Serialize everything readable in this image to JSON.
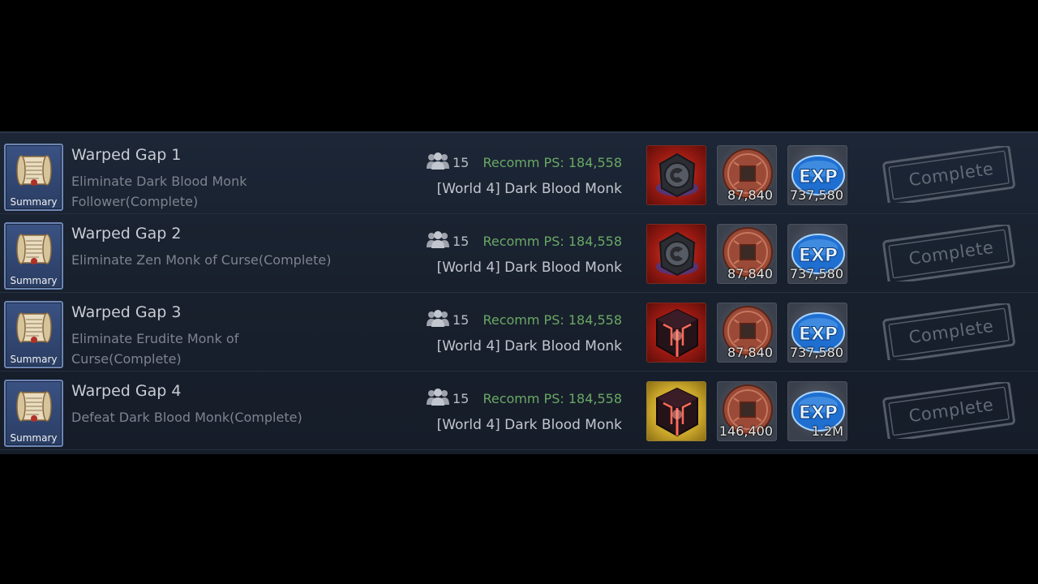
{
  "summary_label": "Summary",
  "complete_label": "Complete",
  "quests": [
    {
      "title": "Warped Gap 1",
      "description": "Eliminate Dark Blood Monk Follower(Complete)",
      "party_size": "15",
      "recomm": "Recomm PS: 184,558",
      "location": "[World 4] Dark Blood Monk",
      "item_icon": "dark-medallion-icon",
      "item_bg": "red",
      "coin_amount": "87,840",
      "exp_amount": "737,580"
    },
    {
      "title": "Warped Gap 2",
      "description": "Eliminate Zen Monk of Curse(Complete)",
      "party_size": "15",
      "recomm": "Recomm PS: 184,558",
      "location": "[World 4] Dark Blood Monk",
      "item_icon": "dark-medallion-icon",
      "item_bg": "red",
      "coin_amount": "87,840",
      "exp_amount": "737,580"
    },
    {
      "title": "Warped Gap 3",
      "description": "Eliminate Erudite Monk of Curse(Complete)",
      "party_size": "15",
      "recomm": "Recomm PS: 184,558",
      "location": "[World 4] Dark Blood Monk",
      "item_icon": "glowing-cube-icon",
      "item_bg": "red",
      "coin_amount": "87,840",
      "exp_amount": "737,580"
    },
    {
      "title": "Warped Gap 4",
      "description": "Defeat Dark Blood Monk(Complete)",
      "party_size": "15",
      "recomm": "Recomm PS: 184,558",
      "location": "[World 4] Dark Blood Monk",
      "item_icon": "glowing-cube-icon",
      "item_bg": "gold",
      "coin_amount": "146,400",
      "exp_amount": "1.2M"
    }
  ],
  "colors": {
    "recomm_green": "#6aa865",
    "panel_bg": "#1a2331",
    "summary_blue": "#324a78"
  }
}
